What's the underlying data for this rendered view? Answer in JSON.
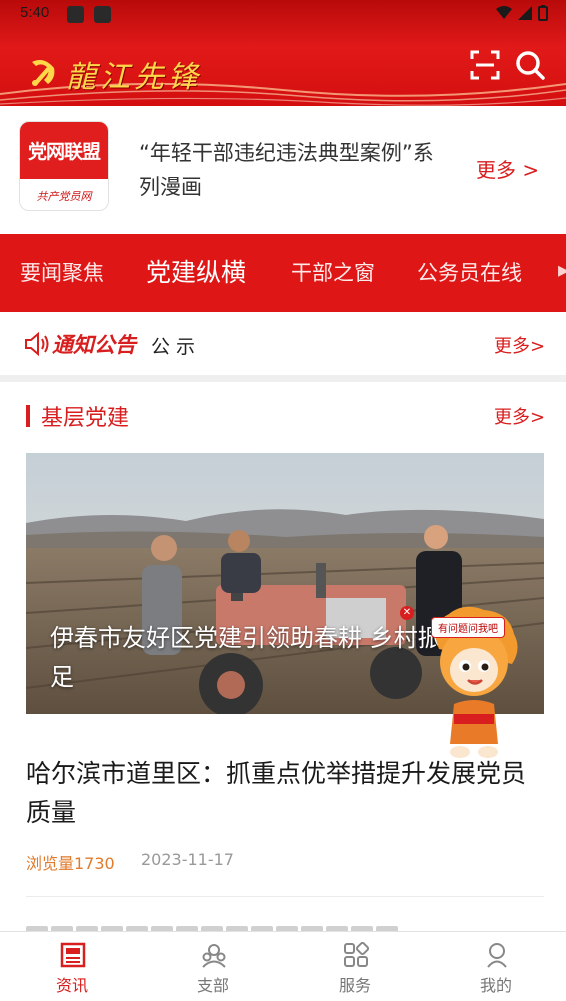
{
  "status_bar": {
    "time": "5:40"
  },
  "header": {
    "app_title": "龍江先锋"
  },
  "league": {
    "logo_top": "党网联盟",
    "logo_bottom": "共产党员网",
    "text": "“年轻干部违纪违法典型案例”系列漫画",
    "more": "更多 >"
  },
  "tabs": [
    {
      "label": "要闻聚焦",
      "active": false
    },
    {
      "label": "党建纵横",
      "active": true
    },
    {
      "label": "干部之窗",
      "active": false
    },
    {
      "label": "公务员在线",
      "active": false
    }
  ],
  "notice": {
    "label": "通知公告",
    "text": "公 示",
    "more": "更多>"
  },
  "section": {
    "title": "基层党建",
    "more": "更多>"
  },
  "feature": {
    "caption": "伊春市友好区党建引领助春耕 乡村振兴动力足"
  },
  "article": {
    "title": "哈尔滨市道里区：抓重点优举措提升发展党员质量",
    "views": "浏览量1730",
    "date": "2023-11-17"
  },
  "mascot": {
    "bubble": "有问题问我吧"
  },
  "bottom_nav": [
    {
      "label": "资讯",
      "icon": "news-icon",
      "active": true
    },
    {
      "label": "支部",
      "icon": "branch-icon",
      "active": false
    },
    {
      "label": "服务",
      "icon": "service-icon",
      "active": false
    },
    {
      "label": "我的",
      "icon": "profile-icon",
      "active": false
    }
  ],
  "colors": {
    "brand_red": "#d81e1e",
    "header_gold": "#ffd84a",
    "views_orange": "#e07b2c"
  }
}
